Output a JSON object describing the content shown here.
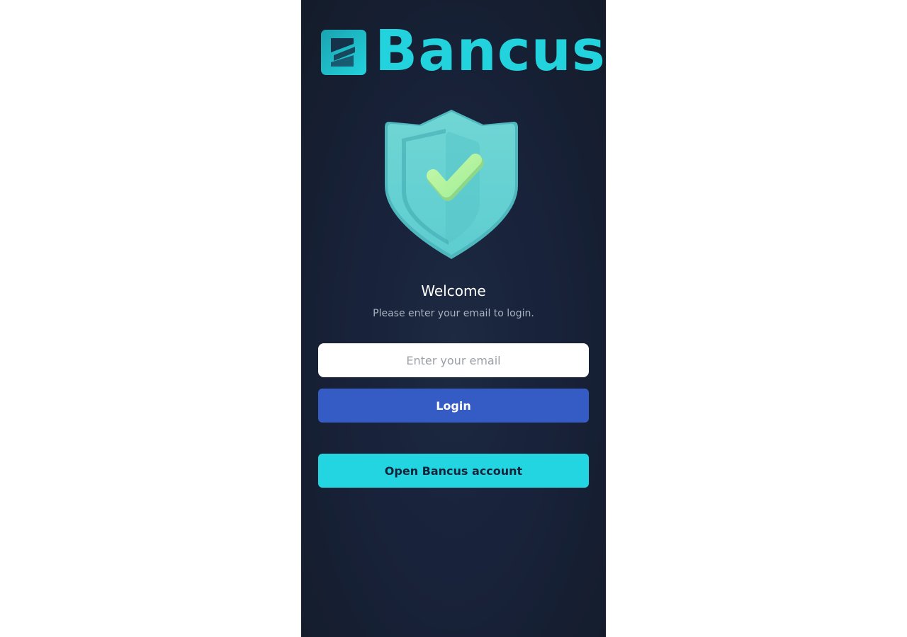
{
  "brand": {
    "name": "Bancus",
    "logo_icon": "bancus-logo-mark",
    "accent_color": "#22d3dd"
  },
  "hero": {
    "icon": "shield-check-icon"
  },
  "login": {
    "title": "Welcome",
    "subtitle": "Please enter your email to login.",
    "email_placeholder": "Enter your email",
    "email_value": "",
    "login_label": "Login",
    "open_account_label": "Open Bancus account"
  },
  "colors": {
    "panel_background": "#18223a",
    "login_button": "#355bc4",
    "open_account_button": "#22d5e0"
  }
}
